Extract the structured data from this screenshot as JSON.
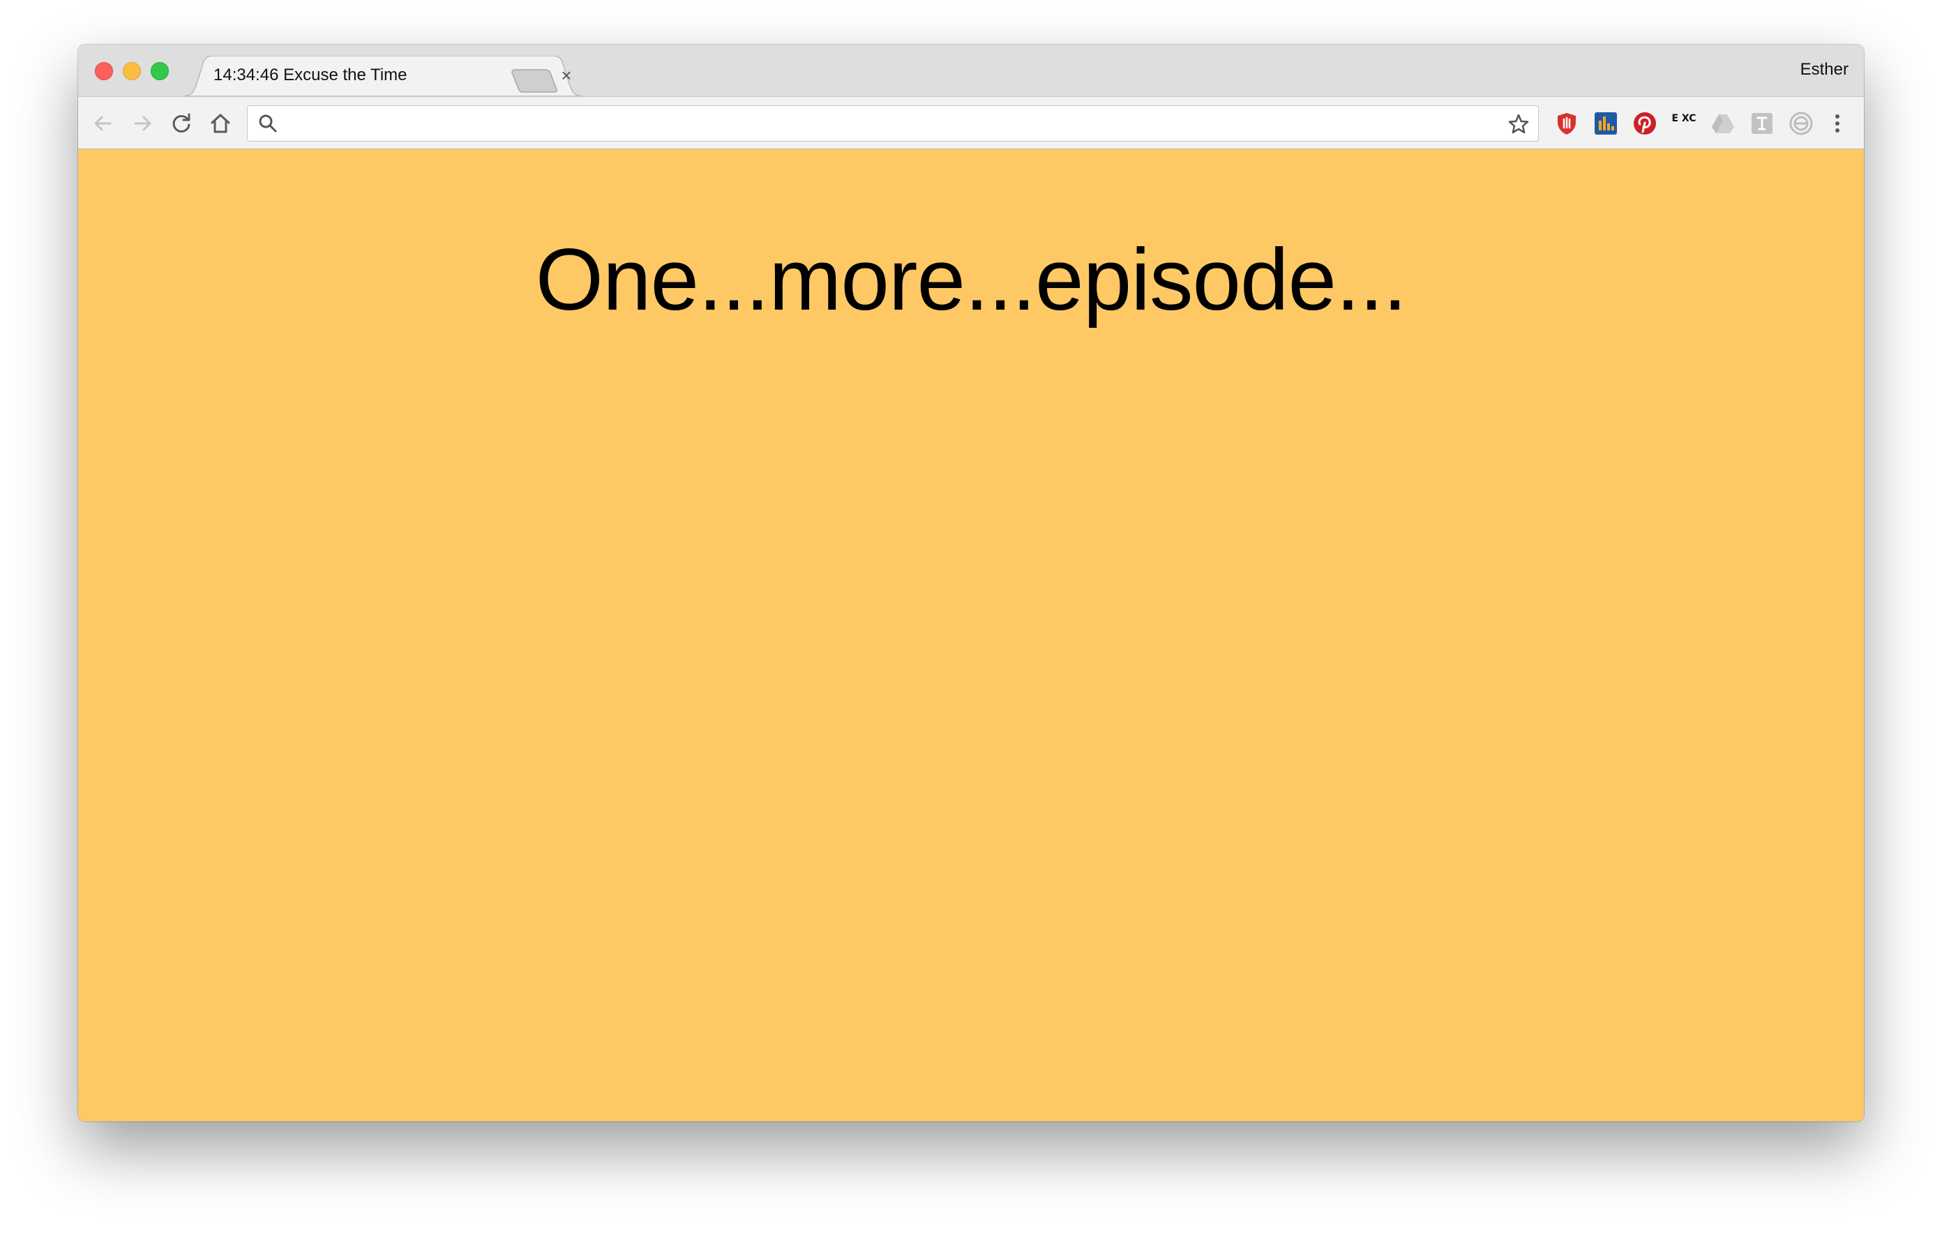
{
  "window": {
    "tab_title": "14:34:46 Excuse the Time",
    "tab_close": "×",
    "profile_name": "Esther"
  },
  "toolbar": {
    "address_value": "",
    "address_placeholder": "",
    "extension_icons": [
      "ublock-icon",
      "bar-chart-extension-icon",
      "pinterest-icon",
      "exc-extension-icon",
      "drive-icon",
      "translate-extension-icon",
      "sync-extension-icon"
    ],
    "xc_label": "E XC"
  },
  "content": {
    "background_color": "#fec965",
    "headline": "One...more...episode..."
  }
}
